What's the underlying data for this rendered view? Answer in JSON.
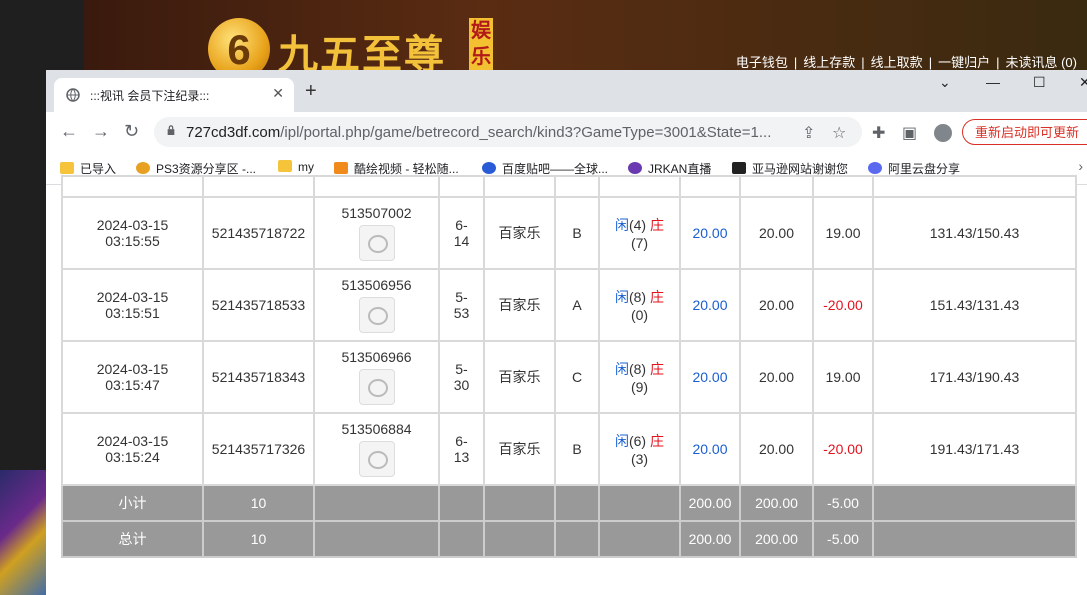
{
  "site": {
    "logo_digit": "6",
    "logo_text": "九五至尊",
    "logo_badge": "娱乐",
    "nav": [
      "电子钱包",
      "线上存款",
      "线上取款",
      "一键归户",
      "未读讯息 (0)"
    ]
  },
  "browser": {
    "tab_title": ":::视讯 会员下注纪录:::",
    "url_host": "727cd3df.com",
    "url_path": "/ipl/portal.php/game/betrecord_search/kind3?GameType=3001&State=1...",
    "relaunch_label": "重新启动即可更新",
    "bookmarks": [
      "已导入",
      "PS3资源分享区 -...",
      "my",
      "酷绘视频 - 轻松随...",
      "百度贴吧——全球...",
      "JRKAN直播",
      "亚马逊网站谢谢您",
      "阿里云盘分享"
    ]
  },
  "records": [
    {
      "date": "2024-03-15",
      "time": "03:15:55",
      "bet_id": "521435718722",
      "round_id": "513507002",
      "shoe1": "6-",
      "shoe2": "14",
      "game": "百家乐",
      "table": "B",
      "p_label": "闲",
      "p_val": "(4)",
      "b_label": "庄",
      "b_val": "(7)",
      "bet": "20.00",
      "valid": "20.00",
      "win": "19.00",
      "balance": "131.43/150.43",
      "win_neg": false
    },
    {
      "date": "2024-03-15",
      "time": "03:15:51",
      "bet_id": "521435718533",
      "round_id": "513506956",
      "shoe1": "5-",
      "shoe2": "53",
      "game": "百家乐",
      "table": "A",
      "p_label": "闲",
      "p_val": "(8)",
      "b_label": "庄",
      "b_val": "(0)",
      "bet": "20.00",
      "valid": "20.00",
      "win": "-20.00",
      "balance": "151.43/131.43",
      "win_neg": true
    },
    {
      "date": "2024-03-15",
      "time": "03:15:47",
      "bet_id": "521435718343",
      "round_id": "513506966",
      "shoe1": "5-",
      "shoe2": "30",
      "game": "百家乐",
      "table": "C",
      "p_label": "闲",
      "p_val": "(8)",
      "b_label": "庄",
      "b_val": "(9)",
      "bet": "20.00",
      "valid": "20.00",
      "win": "19.00",
      "balance": "171.43/190.43",
      "win_neg": false
    },
    {
      "date": "2024-03-15",
      "time": "03:15:24",
      "bet_id": "521435717326",
      "round_id": "513506884",
      "shoe1": "6-",
      "shoe2": "13",
      "game": "百家乐",
      "table": "B",
      "p_label": "闲",
      "p_val": "(6)",
      "b_label": "庄",
      "b_val": "(3)",
      "bet": "20.00",
      "valid": "20.00",
      "win": "-20.00",
      "balance": "191.43/171.43",
      "win_neg": true
    }
  ],
  "subtotal": {
    "label": "小计",
    "count": "10",
    "bet": "200.00",
    "valid": "200.00",
    "win": "-5.00"
  },
  "total": {
    "label": "总计",
    "count": "10",
    "bet": "200.00",
    "valid": "200.00",
    "win": "-5.00"
  },
  "colors": {
    "bet": "#1a5fd0",
    "negative": "#e0141e",
    "summary_bg": "#999999"
  }
}
